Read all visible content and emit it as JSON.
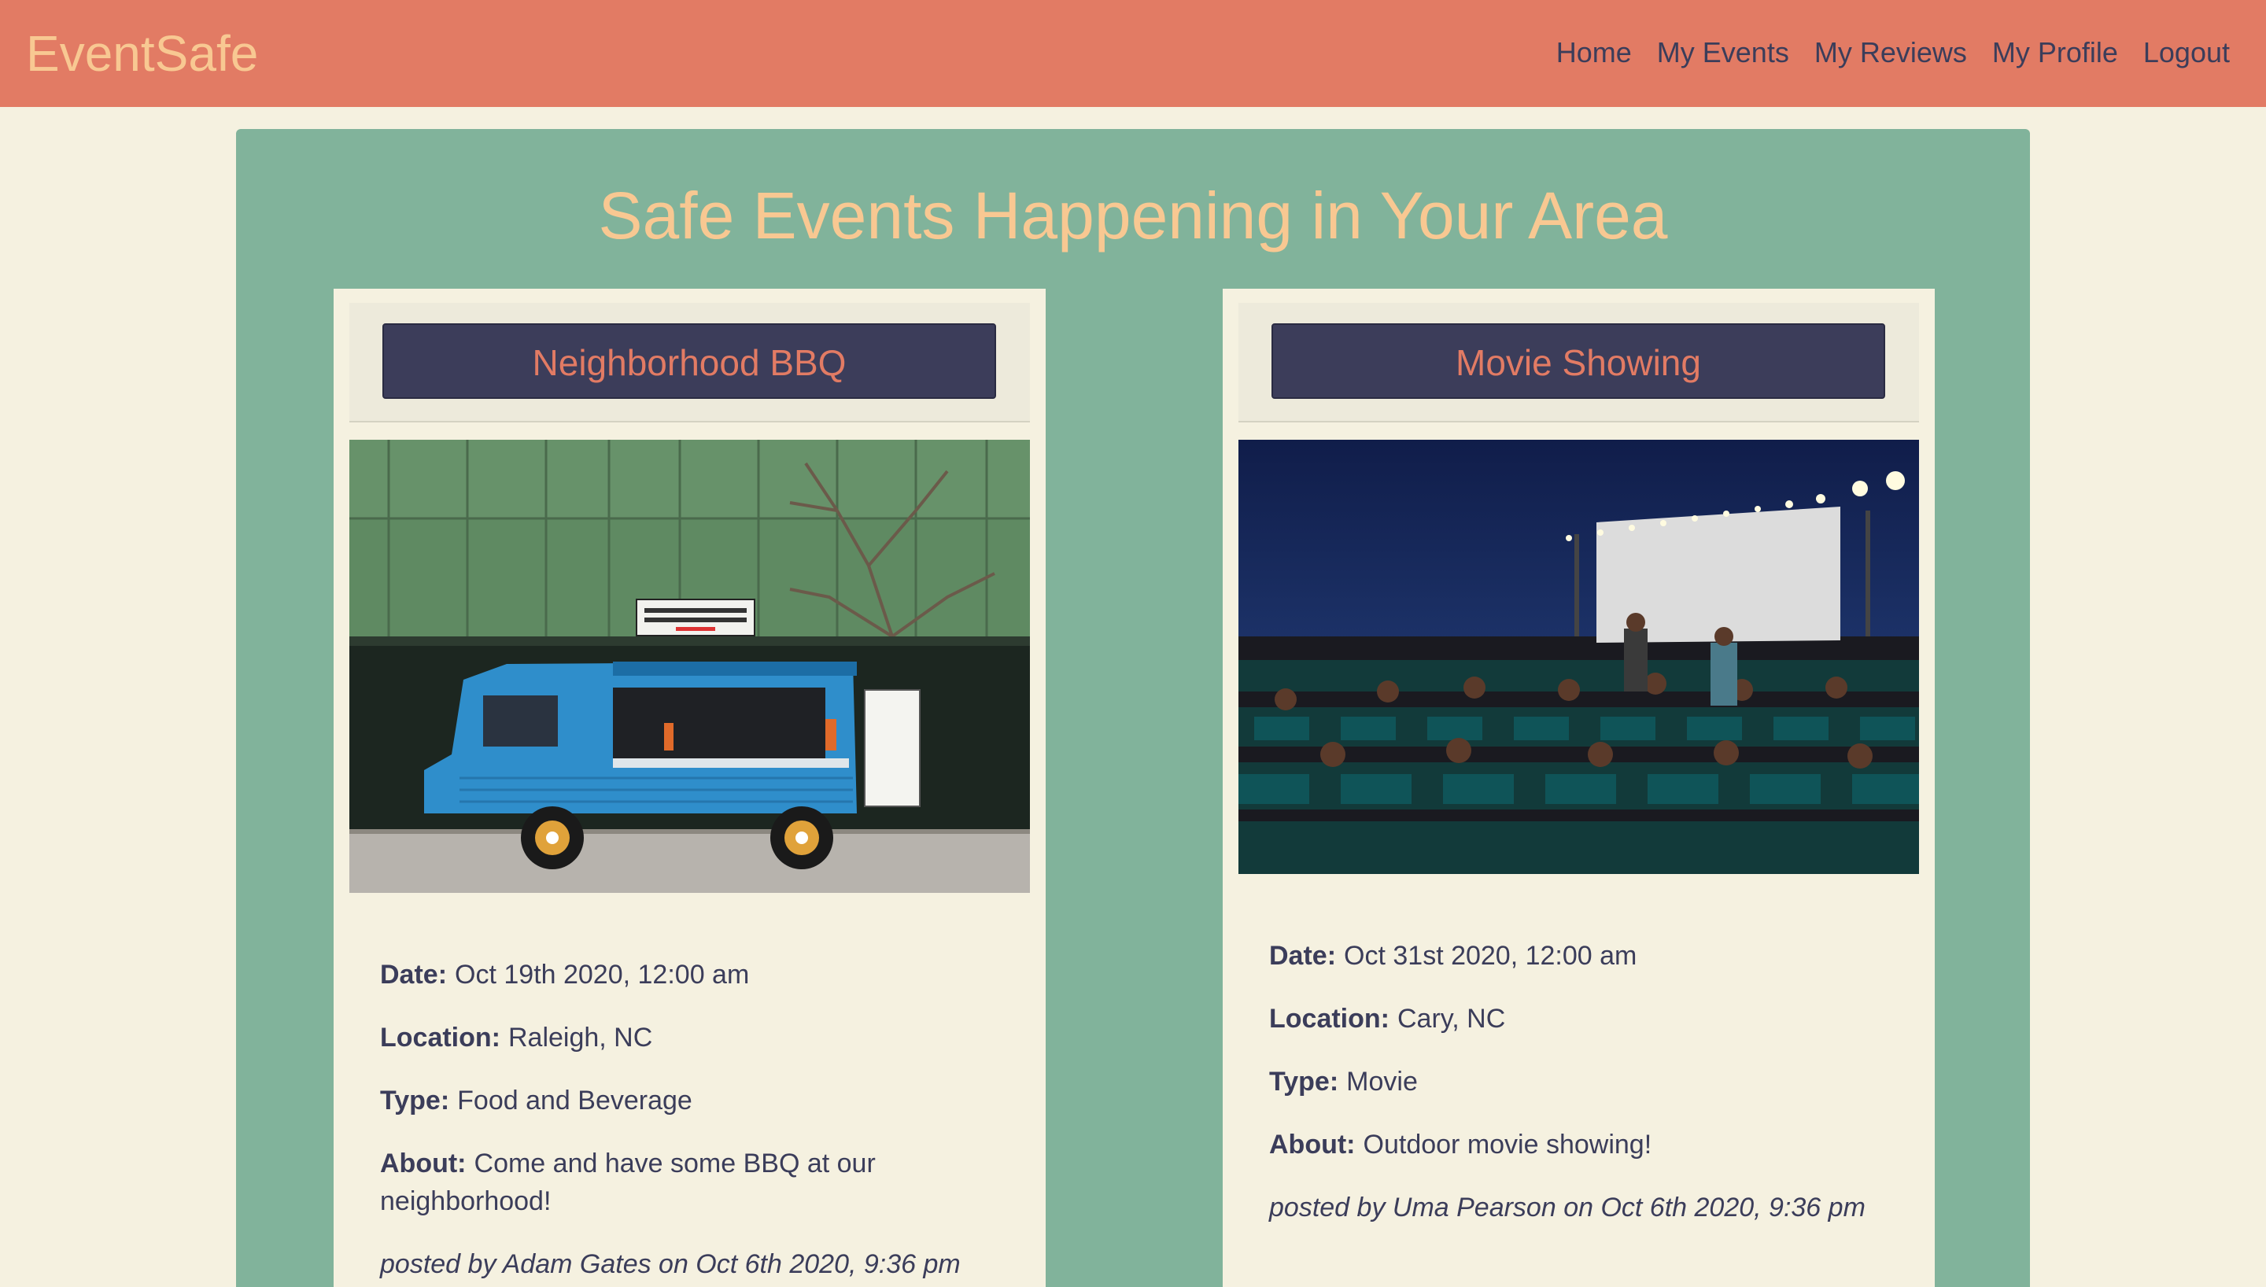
{
  "navbar": {
    "brand": "EventSafe",
    "links": [
      "Home",
      "My Events",
      "My Reviews",
      "My Profile",
      "Logout"
    ]
  },
  "page": {
    "title": "Safe Events Happening in Your Area"
  },
  "events": [
    {
      "title": "Neighborhood BBQ",
      "image": "food-truck-photo",
      "date_label": "Date:",
      "date": "Oct 19th 2020, 12:00 am",
      "location_label": "Location:",
      "location": "Raleigh, NC",
      "type_label": "Type:",
      "type": "Food and Beverage",
      "about_label": "About:",
      "about": "Come and have some BBQ at our neighborhood!",
      "posted": "posted by Adam Gates on Oct 6th 2020, 9:36 pm"
    },
    {
      "title": "Movie Showing",
      "image": "outdoor-cinema-photo",
      "date_label": "Date:",
      "date": "Oct 31st 2020, 12:00 am",
      "location_label": "Location:",
      "location": "Cary, NC",
      "type_label": "Type:",
      "type": "Movie",
      "about_label": "About:",
      "about": "Outdoor movie showing!",
      "posted": "posted by Uma Pearson on Oct 6th 2020, 9:36 pm"
    }
  ],
  "colors": {
    "navbar": "#e27b64",
    "brand": "#f8c892",
    "panel": "#81b39b",
    "card": "#f5f1e0",
    "title_button": "#3c3d5a",
    "text": "#3b3d5a"
  }
}
